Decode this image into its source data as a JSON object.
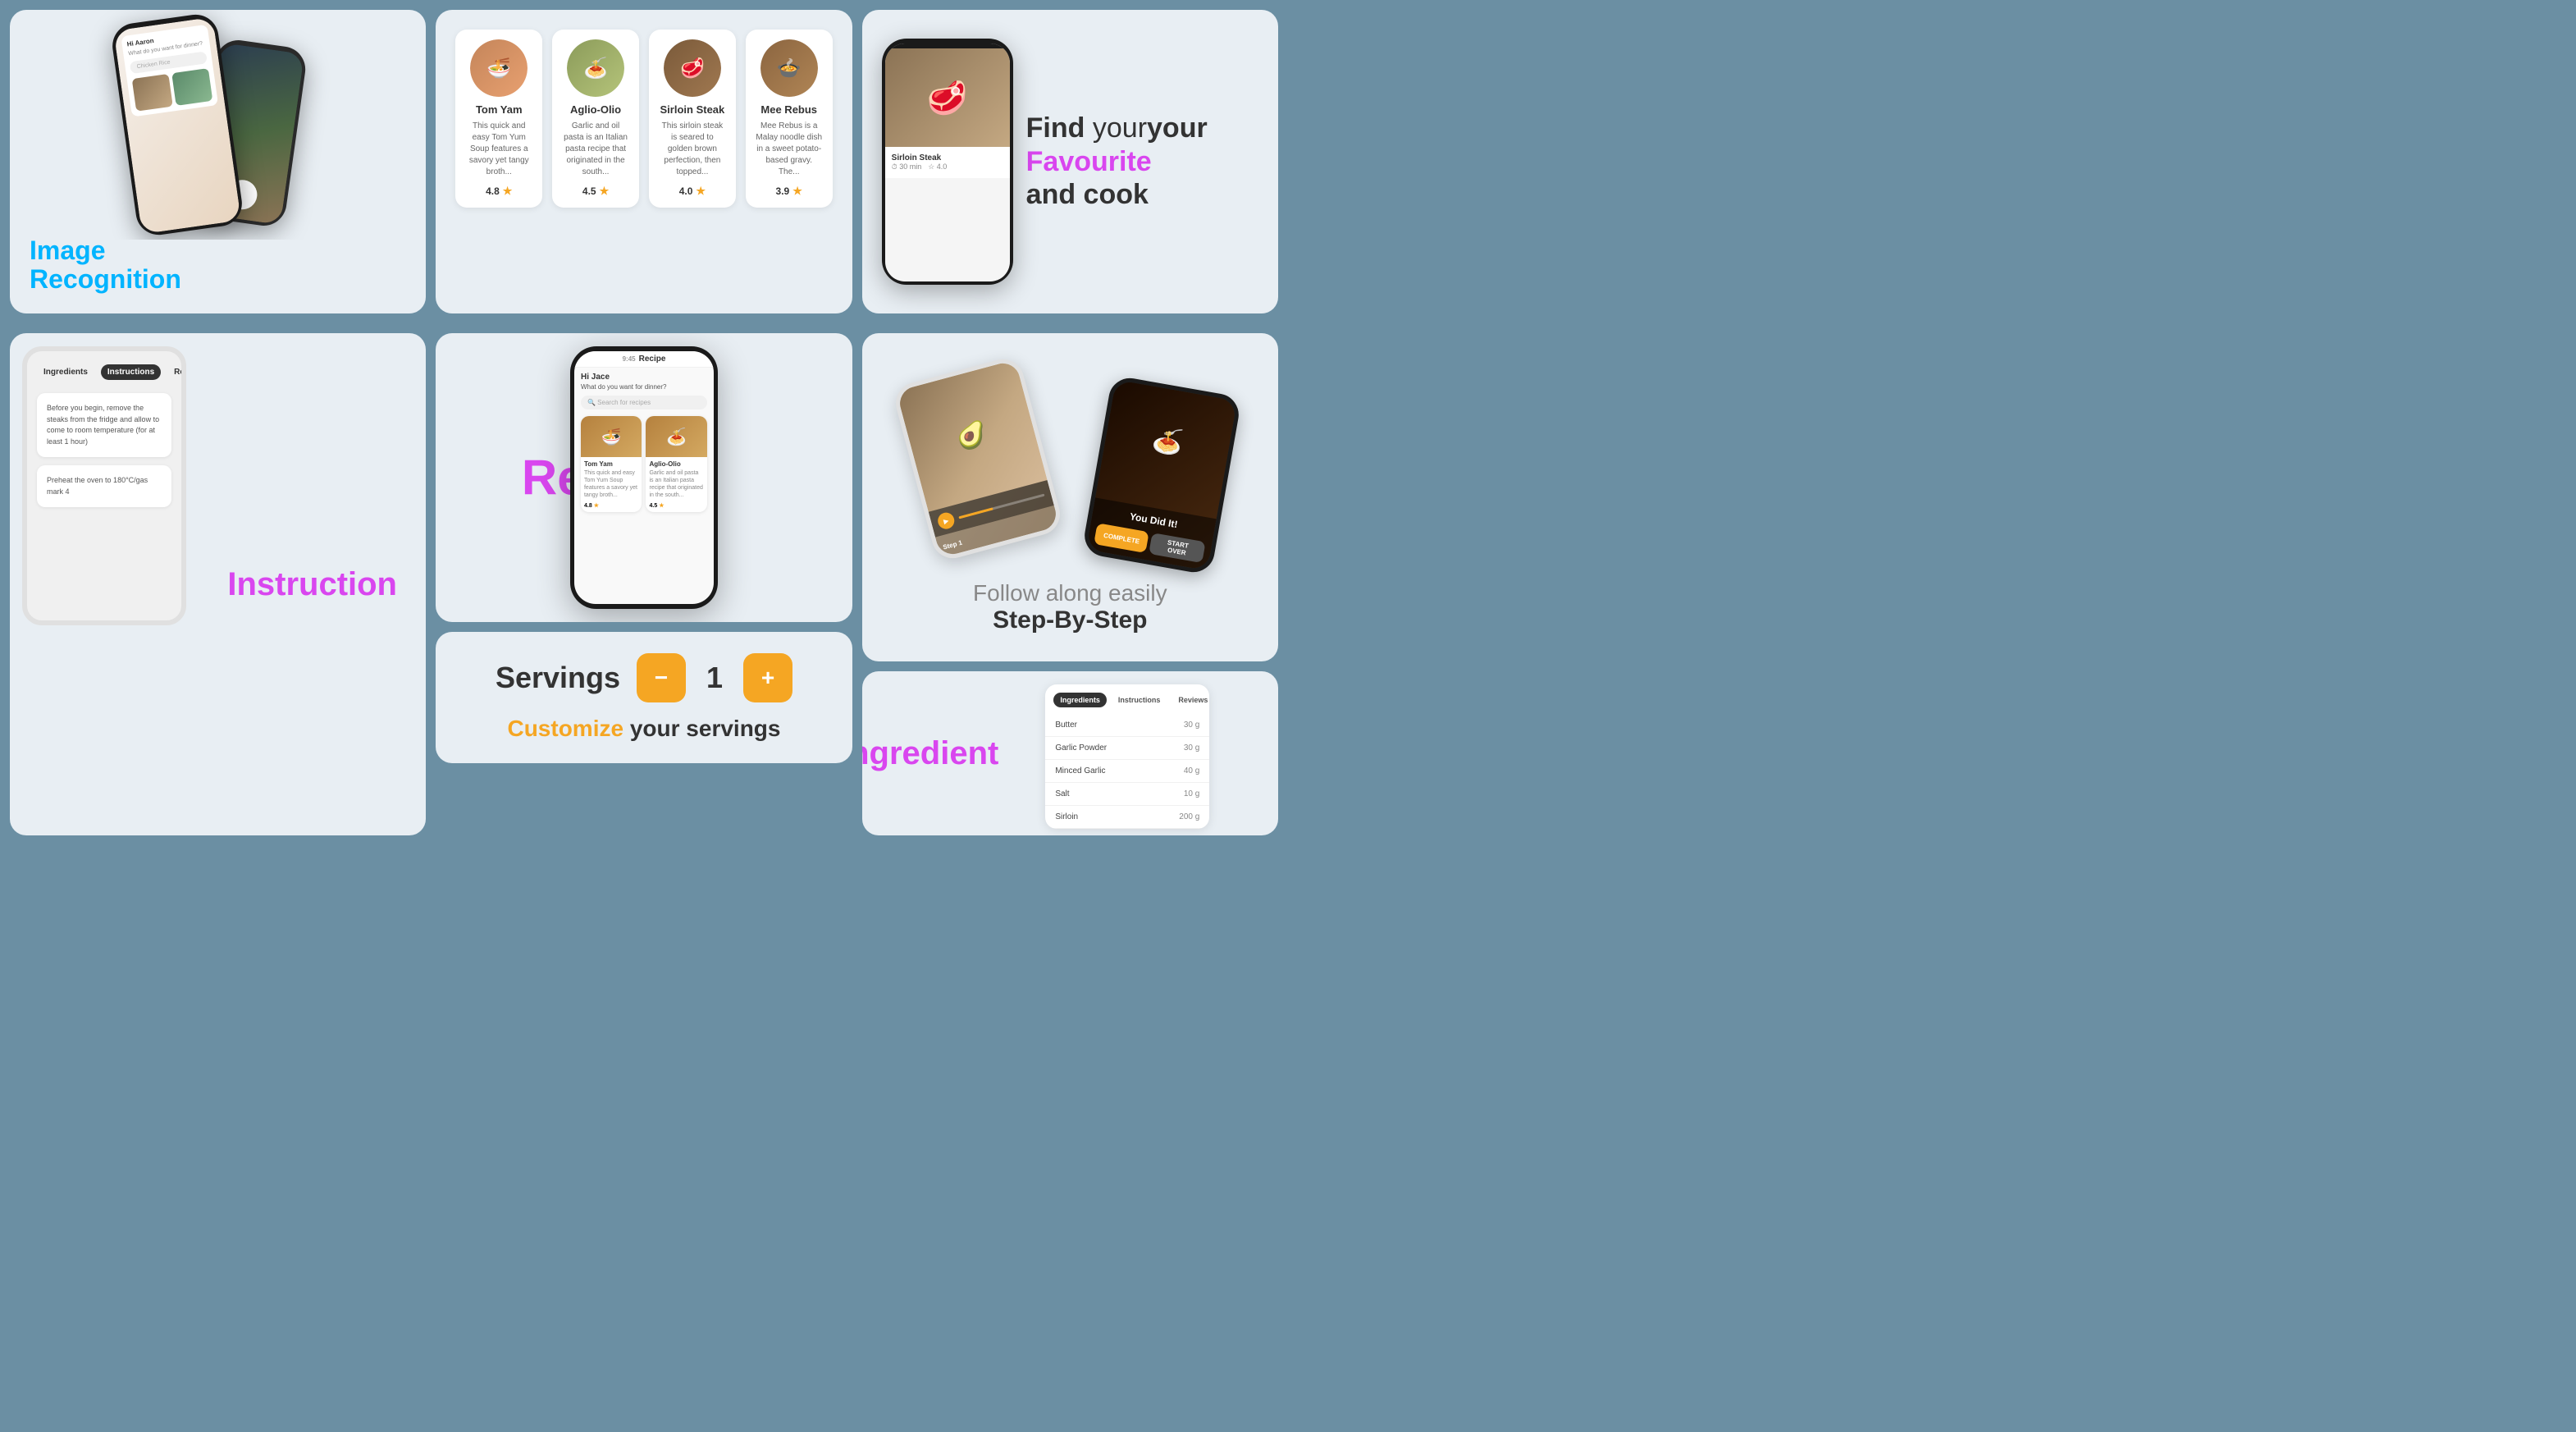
{
  "bg_color": "#6b8fa3",
  "top_row": {
    "image_recognition": {
      "line1": "Image",
      "line2": "Recognition"
    },
    "recipes": {
      "items": [
        {
          "name": "Tom Yam",
          "description": "This quick and easy Tom Yum Soup features a savory yet tangy broth...",
          "rating": "4.8",
          "color1": "#c4855a",
          "color2": "#e8a070",
          "emoji": "🍜"
        },
        {
          "name": "Aglio-Olio",
          "description": "Garlic and oil pasta is an Italian pasta recipe that originated in the south...",
          "rating": "4.5",
          "color1": "#8b9b5a",
          "color2": "#b5c47a",
          "emoji": "🍝"
        },
        {
          "name": "Sirloin Steak",
          "description": "This sirloin steak is seared to golden brown perfection, then topped...",
          "rating": "4.0",
          "color1": "#7a5a3a",
          "color2": "#a07850",
          "emoji": "🥩"
        },
        {
          "name": "Mee Rebus",
          "description": "Mee Rebus is a Malay noodle dish in a sweet potato-based gravy. The...",
          "rating": "3.9",
          "color1": "#8b6540",
          "color2": "#b08555",
          "emoji": "🍲"
        }
      ]
    },
    "find_favourite": {
      "find": "Find",
      "your": "your",
      "favourite": "Favourite",
      "and_cook": "and cook",
      "dish_name": "Sirloin Steak",
      "time": "30 min",
      "rating": "4.0"
    }
  },
  "bottom_row": {
    "instruction": {
      "label": "Instruction",
      "tabs": [
        "Ingredients",
        "Instructions",
        "Reviews"
      ],
      "active_tab": "Instructions",
      "steps": [
        "Before you begin, remove the steaks from the fridge and allow to come to room temperature (for at least 1 hour)",
        "Preheat the oven to 180°C/gas mark 4"
      ]
    },
    "recipe_app": {
      "label": "Recipe",
      "screen": {
        "title": "Recipe",
        "greeting": "Hi Jace",
        "question": "What do you want for dinner?",
        "search_placeholder": "Search for recipes",
        "foods": [
          {
            "name": "Tom Yam",
            "desc": "This quick and easy Tom Yum Soup features a savory yet tangy broth...",
            "rating": "4.8",
            "emoji": "🍜"
          },
          {
            "name": "Aglio-Olio",
            "desc": "Garlic and oil pasta is an Italian pasta recipe that originated in the south...",
            "rating": "4.5",
            "emoji": "🍝"
          }
        ]
      }
    },
    "follow_along": {
      "line1": "Follow along easily",
      "line2": "Step-By-Step",
      "you_did_it": "You Did It!",
      "complete": "COMPLETE",
      "start_over": "START OVER"
    },
    "ingredient": {
      "label": "Ingredient",
      "tabs": [
        "Ingredients",
        "Instructions",
        "Reviews"
      ],
      "active_tab": "Ingredients",
      "items": [
        {
          "name": "Butter",
          "amount": "30 g"
        },
        {
          "name": "Garlic Powder",
          "amount": "30 g"
        },
        {
          "name": "Minced Garlic",
          "amount": "40 g"
        },
        {
          "name": "Salt",
          "amount": "10 g"
        },
        {
          "name": "Sirloin",
          "amount": "200 g"
        }
      ]
    },
    "servings": {
      "label": "Servings",
      "count": "1",
      "customize_prefix": "Customize",
      "customize_suffix": "your servings"
    }
  }
}
